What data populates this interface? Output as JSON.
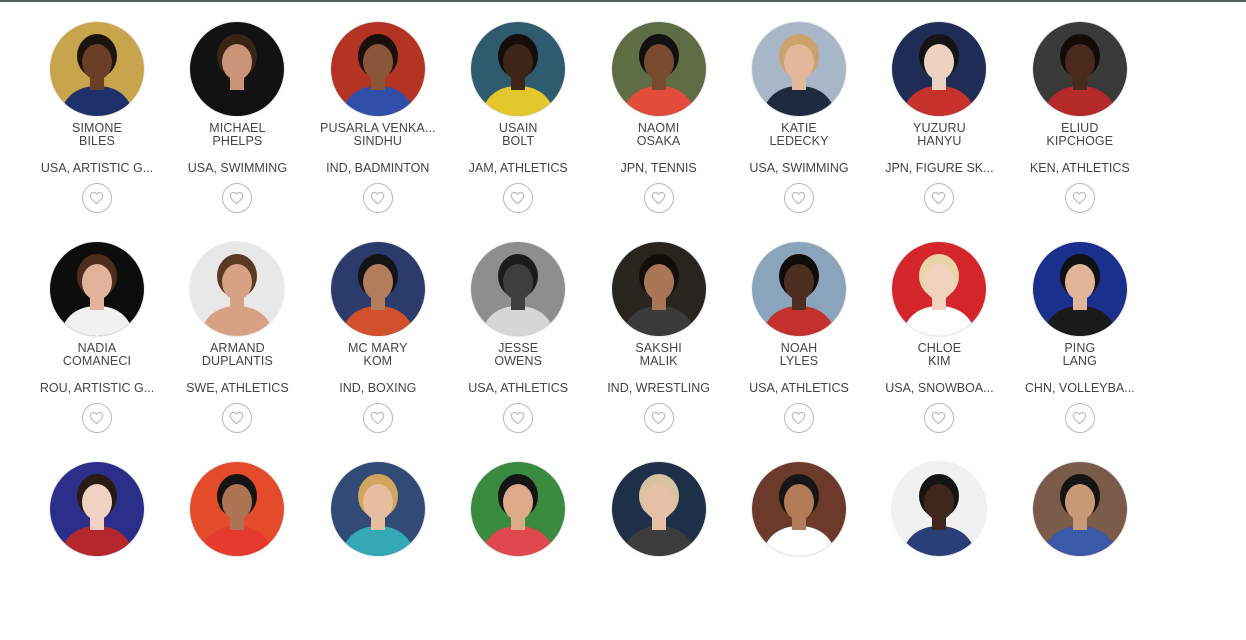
{
  "athletes": [
    {
      "first": "SIMONE",
      "last": "BILES",
      "meta": "USA, ARTISTIC G...",
      "bg": "#c8a44d",
      "skin": "#6b3f26",
      "hair": "#1d130e",
      "shirt": "#1e2f6a"
    },
    {
      "first": "MICHAEL",
      "last": "PHELPS",
      "meta": "USA, SWIMMING",
      "bg": "#121212",
      "skin": "#c99478",
      "hair": "#3a2415",
      "shirt": "#111111"
    },
    {
      "first": "PUSARLA VENKA...",
      "last": "SINDHU",
      "meta": "IND, BADMINTON",
      "bg": "#b43424",
      "skin": "#8a5639",
      "hair": "#1a0f0b",
      "shirt": "#2f4fa8"
    },
    {
      "first": "USAIN",
      "last": "BOLT",
      "meta": "JAM, ATHLETICS",
      "bg": "#2f5b6e",
      "skin": "#3e2519",
      "hair": "#150d09",
      "shirt": "#e4c72c"
    },
    {
      "first": "NAOMI",
      "last": "OSAKA",
      "meta": "JPN, TENNIS",
      "bg": "#5e6d44",
      "skin": "#7a4a30",
      "hair": "#111111",
      "shirt": "#e34b3a"
    },
    {
      "first": "KATIE",
      "last": "LEDECKY",
      "meta": "USA, SWIMMING",
      "bg": "#a8b7c8",
      "skin": "#e3b79a",
      "hair": "#c9a36a",
      "shirt": "#1f2940"
    },
    {
      "first": "YUZURU",
      "last": "HANYU",
      "meta": "JPN, FIGURE SK...",
      "bg": "#1f2d56",
      "skin": "#ecd2bf",
      "hair": "#141414",
      "shirt": "#c8322c"
    },
    {
      "first": "ELIUD",
      "last": "KIPCHOGE",
      "meta": "KEN, ATHLETICS",
      "bg": "#3a3a3a",
      "skin": "#4a2a1c",
      "hair": "#120c08",
      "shirt": "#b42b29"
    },
    {
      "first": "NADIA",
      "last": "COMANECI",
      "meta": "ROU, ARTISTIC G...",
      "bg": "#0d0d0d",
      "skin": "#e1b39b",
      "hair": "#4d2d1b",
      "shirt": "#f1f1f1"
    },
    {
      "first": "ARMAND",
      "last": "DUPLANTIS",
      "meta": "SWE, ATHLETICS",
      "bg": "#e8e8e8",
      "skin": "#d7a184",
      "hair": "#5a3a23",
      "shirt": "#d7a184"
    },
    {
      "first": "MC MARY",
      "last": "KOM",
      "meta": "IND, BOXING",
      "bg": "#2b3c6c",
      "skin": "#b37c5b",
      "hair": "#141414",
      "shirt": "#d2512c"
    },
    {
      "first": "JESSE",
      "last": "OWENS",
      "meta": "USA, ATHLETICS",
      "bg": "#8e8e8e",
      "skin": "#3e3e3e",
      "hair": "#1c1c1c",
      "shirt": "#d6d6d6"
    },
    {
      "first": "SAKSHI",
      "last": "MALIK",
      "meta": "IND, WRESTLING",
      "bg": "#2a241e",
      "skin": "#aa7658",
      "hair": "#130d0a",
      "shirt": "#3b3b3b"
    },
    {
      "first": "NOAH",
      "last": "LYLES",
      "meta": "USA, ATHLETICS",
      "bg": "#8aa5bb",
      "skin": "#4d2f21",
      "hair": "#0f0b08",
      "shirt": "#c4302b"
    },
    {
      "first": "CHLOE",
      "last": "KIM",
      "meta": "USA, SNOWBOA...",
      "bg": "#d4262a",
      "skin": "#f0d2bf",
      "hair": "#e8d6a8",
      "shirt": "#ffffff"
    },
    {
      "first": "PING",
      "last": "LANG",
      "meta": "CHN, VOLLEYBA...",
      "bg": "#1b2f8c",
      "skin": "#e0b59a",
      "hair": "#111111",
      "shirt": "#1a1a1a"
    },
    {
      "first": "",
      "last": "",
      "meta": "",
      "bg": "#2c2f8a",
      "skin": "#efd2c1",
      "hair": "#2a1a12",
      "shirt": "#b5262d"
    },
    {
      "first": "",
      "last": "",
      "meta": "",
      "bg": "#e34b2a",
      "skin": "#ad7553",
      "hair": "#141414",
      "shirt": "#e53a2d"
    },
    {
      "first": "",
      "last": "",
      "meta": "",
      "bg": "#324a76",
      "skin": "#e7bd9f",
      "hair": "#d0a560",
      "shirt": "#35a8b6"
    },
    {
      "first": "",
      "last": "",
      "meta": "",
      "bg": "#3a8a3f",
      "skin": "#dcaa88",
      "hair": "#141414",
      "shirt": "#e0484d"
    },
    {
      "first": "",
      "last": "",
      "meta": "",
      "bg": "#1d3048",
      "skin": "#e6c0a4",
      "hair": "#d7c3a0",
      "shirt": "#3c3c3c"
    },
    {
      "first": "",
      "last": "",
      "meta": "",
      "bg": "#6c3a2a",
      "skin": "#b27c56",
      "hair": "#161616",
      "shirt": "#ffffff"
    },
    {
      "first": "",
      "last": "",
      "meta": "",
      "bg": "#f1f1f1",
      "skin": "#3f271b",
      "hair": "#141414",
      "shirt": "#2a3f78"
    },
    {
      "first": "",
      "last": "",
      "meta": "",
      "bg": "#7a5a48",
      "skin": "#c89a78",
      "hair": "#141414",
      "shirt": "#3a5aa8"
    }
  ],
  "colors": {
    "text": "#444444",
    "favorite_border": "#b8b8b8",
    "favorite_icon": "#b8b8b8",
    "top_rule": "#56605a"
  },
  "icons": {
    "favorite": "heart-icon"
  }
}
